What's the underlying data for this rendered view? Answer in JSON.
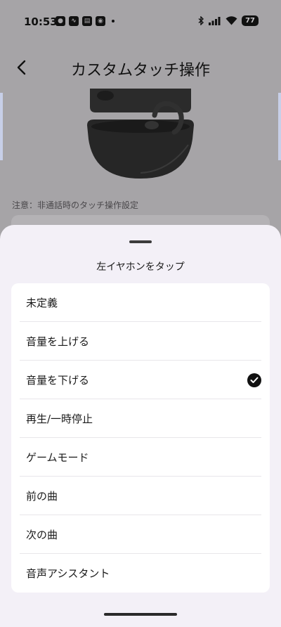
{
  "status_bar": {
    "time": "10:53",
    "battery": "77",
    "icons": [
      "notification-icon",
      "activity-icon",
      "news-icon",
      "app-icon",
      "bluetooth-icon",
      "signal-icon",
      "wifi-icon",
      "battery-icon"
    ]
  },
  "header": {
    "title": "カスタムタッチ操作",
    "back_icon": "chevron-left-icon"
  },
  "notice": "注意：非通話時のタッチ操作設定",
  "sheet": {
    "title": "左イヤホンをタップ",
    "options": [
      {
        "label": "未定義",
        "selected": false
      },
      {
        "label": "音量を上げる",
        "selected": false
      },
      {
        "label": "音量を下げる",
        "selected": true
      },
      {
        "label": "再生/一時停止",
        "selected": false
      },
      {
        "label": "ゲームモード",
        "selected": false
      },
      {
        "label": "前の曲",
        "selected": false
      },
      {
        "label": "次の曲",
        "selected": false
      },
      {
        "label": "音声アシスタント",
        "selected": false
      }
    ]
  },
  "colors": {
    "scrim": "#a6a4a7",
    "sheet_bg": "#f3f0f7",
    "card_bg": "#ffffff",
    "check": "#111111"
  }
}
